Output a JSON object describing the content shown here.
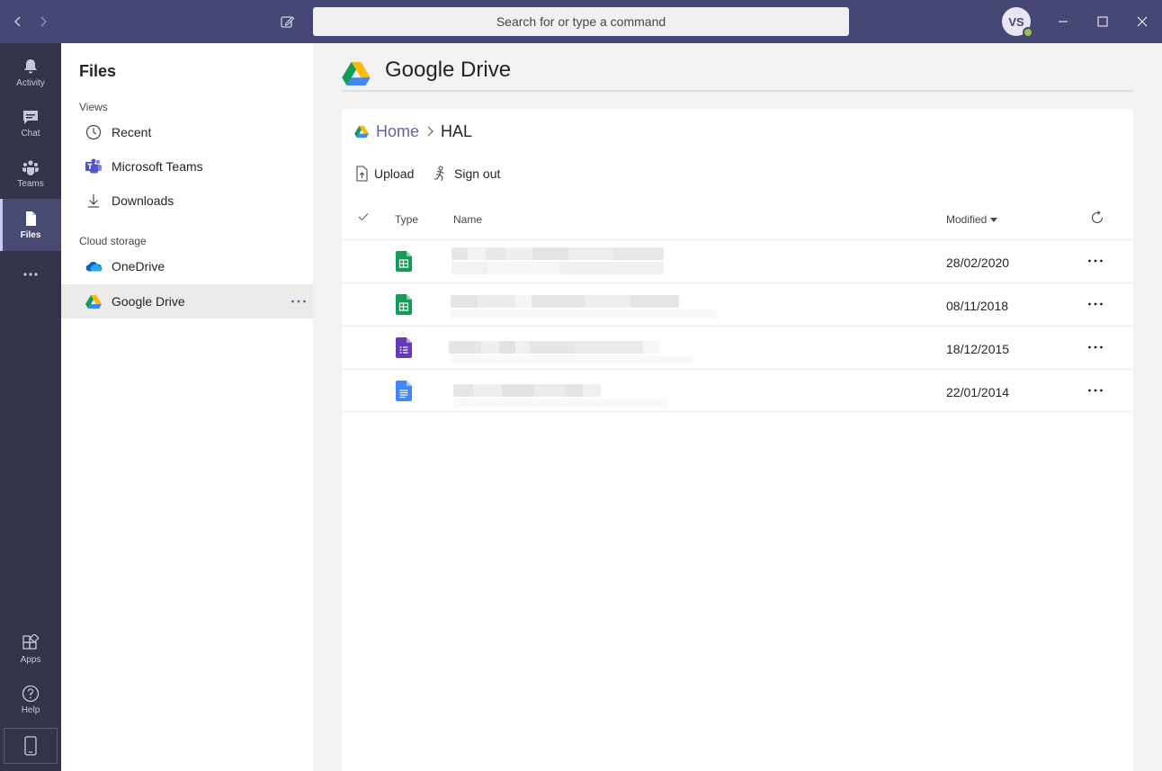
{
  "titlebar": {
    "search_placeholder": "Search for or type a command",
    "avatar_initials": "VS",
    "presence_color": "#92c353"
  },
  "rail": {
    "items": [
      {
        "label": "Activity",
        "icon": "bell-icon"
      },
      {
        "label": "Chat",
        "icon": "chat-icon"
      },
      {
        "label": "Teams",
        "icon": "teams-icon"
      },
      {
        "label": "Files",
        "icon": "file-icon",
        "active": true
      },
      {
        "label": "",
        "icon": "more-icon"
      },
      {
        "label": "Apps",
        "icon": "apps-icon"
      },
      {
        "label": "Help",
        "icon": "help-icon"
      }
    ]
  },
  "sidebar": {
    "title": "Files",
    "views_label": "Views",
    "views": [
      {
        "label": "Recent",
        "icon": "clock-icon"
      },
      {
        "label": "Microsoft Teams",
        "icon": "teams-logo-icon"
      },
      {
        "label": "Downloads",
        "icon": "download-icon"
      }
    ],
    "cloud_label": "Cloud storage",
    "cloud": [
      {
        "label": "OneDrive",
        "icon": "onedrive-icon"
      },
      {
        "label": "Google Drive",
        "icon": "google-drive-icon",
        "selected": true
      }
    ]
  },
  "main": {
    "title": "Google Drive",
    "breadcrumb": {
      "home": "Home",
      "current": "HAL"
    },
    "toolbar": {
      "upload": "Upload",
      "sign_out": "Sign out"
    },
    "columns": {
      "type": "Type",
      "name": "Name",
      "modified": "Modified"
    },
    "files": [
      {
        "type": "sheets-icon",
        "modified": "28/02/2020",
        "color": "#0f9d58"
      },
      {
        "type": "sheets-icon",
        "modified": "08/11/2018",
        "color": "#0f9d58"
      },
      {
        "type": "forms-icon",
        "modified": "18/12/2015",
        "color": "#673ab7"
      },
      {
        "type": "docs-icon",
        "modified": "22/01/2014",
        "color": "#4285f4"
      }
    ]
  },
  "colors": {
    "titlebar": "#464775",
    "rail": "#33344a",
    "accent": "#6264a7"
  }
}
